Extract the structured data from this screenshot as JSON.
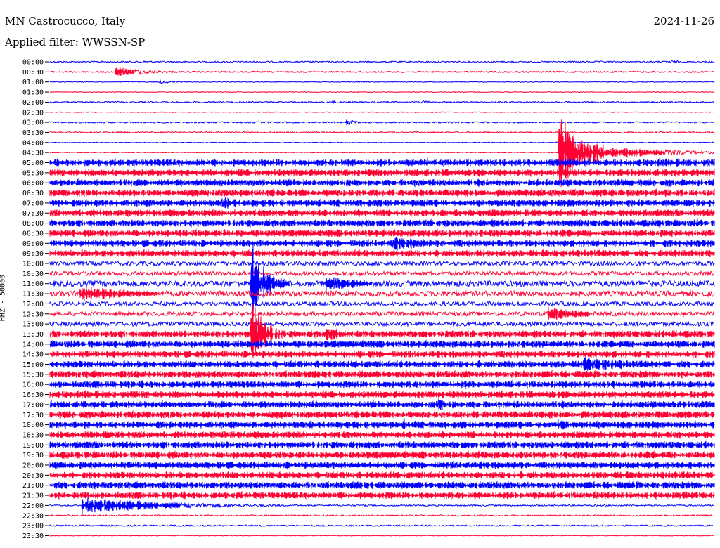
{
  "header": {
    "station": "MN Castrocucco, Italy",
    "date": "2024-11-26",
    "filter": "Applied filter: WWSSN-SP"
  },
  "chart_data": {
    "type": "helicorder",
    "ylabel": "HHZ - 50000",
    "row_interval_minutes": 30,
    "trace_colors": [
      "#0000ff",
      "#ff0033"
    ],
    "rows": [
      {
        "time": "00:00",
        "amp": 1
      },
      {
        "time": "00:30",
        "amp": 1
      },
      {
        "time": "01:00",
        "amp": 0.5
      },
      {
        "time": "01:30",
        "amp": 0.5
      },
      {
        "time": "02:00",
        "amp": 1
      },
      {
        "time": "02:30",
        "amp": 0.5
      },
      {
        "time": "03:00",
        "amp": 1
      },
      {
        "time": "03:30",
        "amp": 1
      },
      {
        "time": "04:00",
        "amp": 0.5
      },
      {
        "time": "04:30",
        "amp": 0.5
      },
      {
        "time": "05:00",
        "amp": 5
      },
      {
        "time": "05:30",
        "amp": 5
      },
      {
        "time": "06:00",
        "amp": 5
      },
      {
        "time": "06:30",
        "amp": 5
      },
      {
        "time": "07:00",
        "amp": 5
      },
      {
        "time": "07:30",
        "amp": 5
      },
      {
        "time": "08:00",
        "amp": 5
      },
      {
        "time": "08:30",
        "amp": 5
      },
      {
        "time": "09:00",
        "amp": 5
      },
      {
        "time": "09:30",
        "amp": 5
      },
      {
        "time": "10:00",
        "amp": 3
      },
      {
        "time": "10:30",
        "amp": 3
      },
      {
        "time": "11:00",
        "amp": 4
      },
      {
        "time": "11:30",
        "amp": 4
      },
      {
        "time": "12:00",
        "amp": 3
      },
      {
        "time": "12:30",
        "amp": 3
      },
      {
        "time": "13:00",
        "amp": 3
      },
      {
        "time": "13:30",
        "amp": 5
      },
      {
        "time": "14:00",
        "amp": 5
      },
      {
        "time": "14:30",
        "amp": 5
      },
      {
        "time": "15:00",
        "amp": 5
      },
      {
        "time": "15:30",
        "amp": 5
      },
      {
        "time": "16:00",
        "amp": 5
      },
      {
        "time": "16:30",
        "amp": 5
      },
      {
        "time": "17:00",
        "amp": 5
      },
      {
        "time": "17:30",
        "amp": 5
      },
      {
        "time": "18:00",
        "amp": 5
      },
      {
        "time": "18:30",
        "amp": 5
      },
      {
        "time": "19:00",
        "amp": 5
      },
      {
        "time": "19:30",
        "amp": 5
      },
      {
        "time": "20:00",
        "amp": 5
      },
      {
        "time": "20:30",
        "amp": 5
      },
      {
        "time": "21:00",
        "amp": 5
      },
      {
        "time": "21:30",
        "amp": 5
      },
      {
        "time": "22:00",
        "amp": 1
      },
      {
        "time": "22:30",
        "amp": 1
      },
      {
        "time": "23:00",
        "amp": 1
      },
      {
        "time": "23:30",
        "amp": 0.5
      }
    ],
    "events": [
      {
        "row": "00:00",
        "minute": 4.1,
        "amp": 2,
        "dur": 1
      },
      {
        "row": "00:00",
        "minute": 28.0,
        "amp": 2,
        "dur": 1
      },
      {
        "row": "00:30",
        "minute": 3.0,
        "amp": 7,
        "dur": 1.5
      },
      {
        "row": "01:00",
        "minute": 5.0,
        "amp": 2,
        "dur": 1
      },
      {
        "row": "02:00",
        "minute": 12.8,
        "amp": 2,
        "dur": 0.6
      },
      {
        "row": "02:00",
        "minute": 16.8,
        "amp": 2,
        "dur": 1
      },
      {
        "row": "03:00",
        "minute": 13.4,
        "amp": 5,
        "dur": 0.4
      },
      {
        "row": "04:30",
        "minute": 23.0,
        "amp": 58,
        "dur": 1.2
      },
      {
        "row": "04:30",
        "minute": 26.0,
        "amp": 8,
        "dur": 2.5
      },
      {
        "row": "07:00",
        "minute": 7.8,
        "amp": 9,
        "dur": 1.5
      },
      {
        "row": "09:00",
        "minute": 15.5,
        "amp": 10,
        "dur": 3
      },
      {
        "row": "11:00",
        "minute": 9.1,
        "amp": 68,
        "dur": 0.6
      },
      {
        "row": "11:00",
        "minute": 12.5,
        "amp": 11,
        "dur": 2
      },
      {
        "row": "11:30",
        "minute": 1.4,
        "amp": 11,
        "dur": 3.5
      },
      {
        "row": "12:30",
        "minute": 22.5,
        "amp": 10,
        "dur": 2
      },
      {
        "row": "13:30",
        "minute": 9.1,
        "amp": 65,
        "dur": 0.6
      },
      {
        "row": "13:30",
        "minute": 12.5,
        "amp": 10,
        "dur": 2
      },
      {
        "row": "15:00",
        "minute": 24.0,
        "amp": 11,
        "dur": 3
      },
      {
        "row": "17:00",
        "minute": 17.5,
        "amp": 9,
        "dur": 1.5
      },
      {
        "row": "18:00",
        "minute": 16.0,
        "amp": 8,
        "dur": 1.5
      },
      {
        "row": "18:00",
        "minute": 23.0,
        "amp": 8,
        "dur": 1.2
      },
      {
        "row": "22:00",
        "minute": 1.5,
        "amp": 12,
        "dur": 4
      }
    ]
  }
}
